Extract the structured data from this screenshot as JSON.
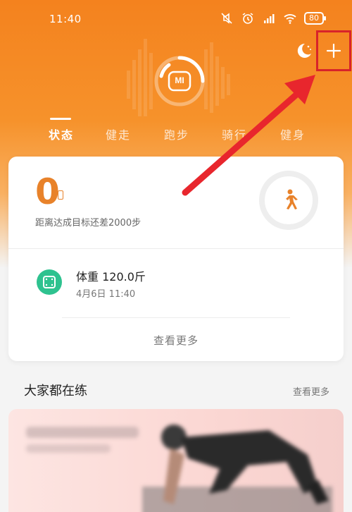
{
  "status_bar": {
    "time": "11:40",
    "battery": "80"
  },
  "header": {
    "logo_text": "MI",
    "icons": [
      "moon-icon",
      "plus-icon"
    ]
  },
  "tabs": [
    {
      "label": "状态",
      "active": true
    },
    {
      "label": "健走",
      "active": false
    },
    {
      "label": "跑步",
      "active": false
    },
    {
      "label": "骑行",
      "active": false
    },
    {
      "label": "健身",
      "active": false
    }
  ],
  "steps_card": {
    "steps": "0",
    "goal_text": "距离达成目标还差2000步"
  },
  "weight_record": {
    "title": "体重 120.0斤",
    "time": "4月6日 11:40"
  },
  "card_more": "查看更多",
  "section": {
    "title": "大家都在练",
    "more": "查看更多"
  },
  "colors": {
    "accent": "#f4821e",
    "steps": "#e8822a",
    "weight_icon": "#2ec28f",
    "highlight": "#d8232a"
  }
}
